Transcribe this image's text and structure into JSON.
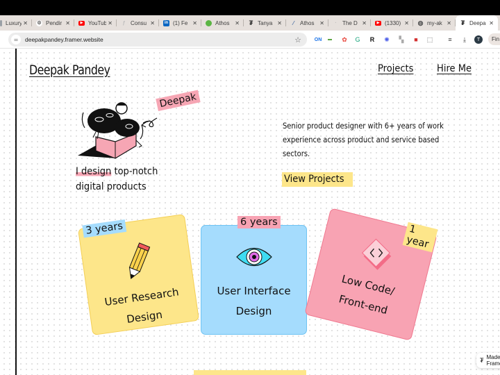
{
  "browser": {
    "tabs": [
      {
        "title": "Luxury",
        "favicon": "generic-page-icon",
        "color": "#9aa0a6"
      },
      {
        "title": "Pendir",
        "favicon": "gear-icon",
        "color": "#777777"
      },
      {
        "title": "YouTub",
        "favicon": "youtube-icon",
        "color": "#ff0000"
      },
      {
        "title": "Consu",
        "favicon": "framer-icon",
        "color": "#bbbbbb"
      },
      {
        "title": "(1) Fe",
        "favicon": "linkedin-icon",
        "color": "#0a66c2"
      },
      {
        "title": "Athos",
        "favicon": "green-circle-icon",
        "color": "#5bb543"
      },
      {
        "title": "Tanya",
        "favicon": "framer-icon",
        "color": "#222222"
      },
      {
        "title": "Athos",
        "favicon": "athos-icon",
        "color": "#4a6fa5"
      },
      {
        "title": "The D",
        "favicon": "generic-page-icon",
        "color": "#bbbbbb"
      },
      {
        "title": "(1330)",
        "favicon": "youtube-icon",
        "color": "#ff0000"
      },
      {
        "title": "my-ak",
        "favicon": "globe-icon",
        "color": "#555555"
      },
      {
        "title": "Deepa",
        "favicon": "framer-icon",
        "color": "#111111",
        "active": true
      }
    ],
    "new_tab": "+",
    "url": "deepakpandey.framer.website",
    "avatar_letter": "T",
    "find_label": "Fin",
    "extensions": [
      "on-extension-icon",
      "new-extension-icon",
      "color-wheel-icon",
      "grammarly-icon",
      "r-extension-icon",
      "sun-extension-icon",
      "bookmark-extension-icon",
      "pdf-icon",
      "puzzle-icon",
      "reading-list-icon",
      "download-icon"
    ]
  },
  "site": {
    "logo": "Deepak Pandey",
    "nav": [
      {
        "label": "Projects"
      },
      {
        "label": "Hire Me"
      }
    ],
    "name_tag": "Deepak",
    "tagline_highlight": "I design",
    "tagline_rest_line1": " top-notch",
    "tagline_line2": "digital products",
    "bio": "Senior product designer with 6+ years of work experience across product and service based sectors.",
    "cta": "View Projects",
    "cards": [
      {
        "badge": "3 years",
        "line1": "User Research",
        "line2": "Design",
        "icon": "pencil-icon",
        "color": "#fde68a",
        "badge_color": "#a5dcfd"
      },
      {
        "badge": "6 years",
        "line1": "User Interface",
        "line2": "Design",
        "icon": "eye-icon",
        "color": "#a5dcfd",
        "badge_color": "#f8a3b3"
      },
      {
        "badge": "1 year",
        "line1": "Low Code/",
        "line2": "Front-end",
        "icon": "code-brackets-icon",
        "color": "#f8a3b3",
        "badge_color": "#fde68a"
      }
    ],
    "made_in": "Made in Framer"
  }
}
